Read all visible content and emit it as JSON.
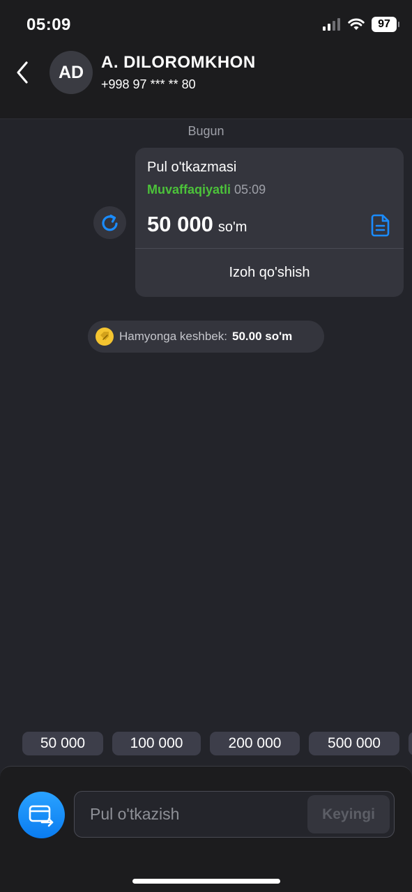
{
  "status_bar": {
    "time": "05:09",
    "battery": "97",
    "icons": [
      "signal-icon",
      "wifi-icon",
      "battery-icon"
    ]
  },
  "header": {
    "avatar_initials": "AD",
    "name": "A. DILOROMKHON",
    "phone": "+998 97 *** ** 80"
  },
  "chat": {
    "date_label": "Bugun",
    "transfer": {
      "title": "Pul o'tkazmasi",
      "status": "Muvaffaqiyatli",
      "time": "05:09",
      "amount": "50 000",
      "currency": "so'm",
      "comment_button": "Izoh qo'shish"
    },
    "cashback": {
      "label": "Hamyonga keshbek:",
      "value": "50.00 so'm"
    }
  },
  "quick_amounts": [
    "50 000",
    "100 000",
    "200 000",
    "500 000"
  ],
  "composer": {
    "placeholder": "Pul o'tkazish",
    "next_label": "Keyingi"
  },
  "colors": {
    "background": "#23242a",
    "bar": "#1c1c1e",
    "bubble": "#34353d",
    "success": "#4cc23a",
    "accent": "#1a8cff"
  }
}
